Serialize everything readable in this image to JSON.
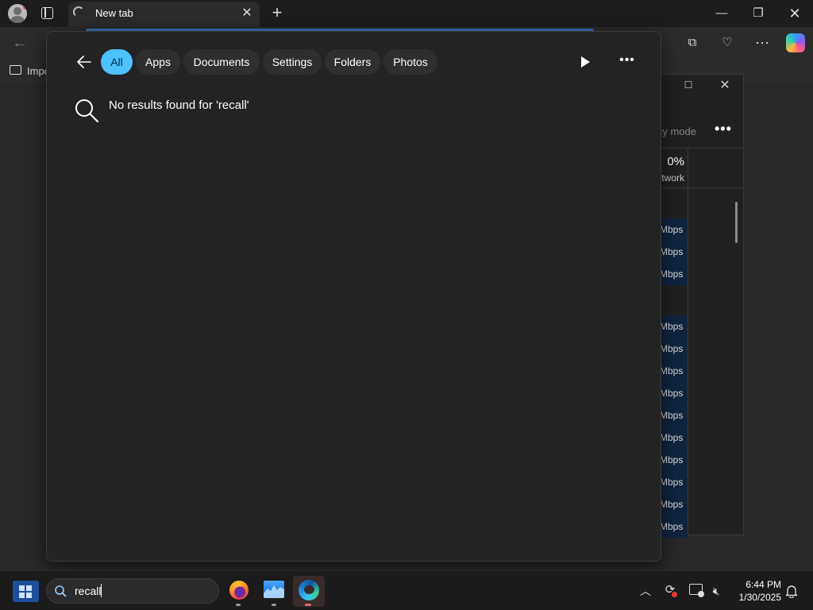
{
  "browser": {
    "tab_title": "New tab",
    "favorites": {
      "folder_label": "Impo"
    }
  },
  "task_manager": {
    "mode_label": "cy mode",
    "network_percent": "0%",
    "network_label": "twork",
    "rows": [
      "Mbps",
      "Mbps",
      "Mbps",
      "Mbps",
      "Mbps",
      "Mbps",
      "Mbps",
      "Mbps",
      "Mbps",
      "Mbps",
      "Mbps",
      "Mbps",
      "Mbps"
    ]
  },
  "search": {
    "filters": [
      "All",
      "Apps",
      "Documents",
      "Settings",
      "Folders",
      "Photos"
    ],
    "active_filter": "All",
    "no_results_text": "No results found for 'recall'",
    "query": "recall"
  },
  "taskbar": {
    "time": "6:44 PM",
    "date": "1/30/2025",
    "apps": [
      "firefox-icon",
      "performance-monitor-icon",
      "edge-icon"
    ]
  },
  "colors": {
    "accent": "#4cc2ff",
    "panel": "#232323",
    "taskbar": "#1b1b1b"
  }
}
